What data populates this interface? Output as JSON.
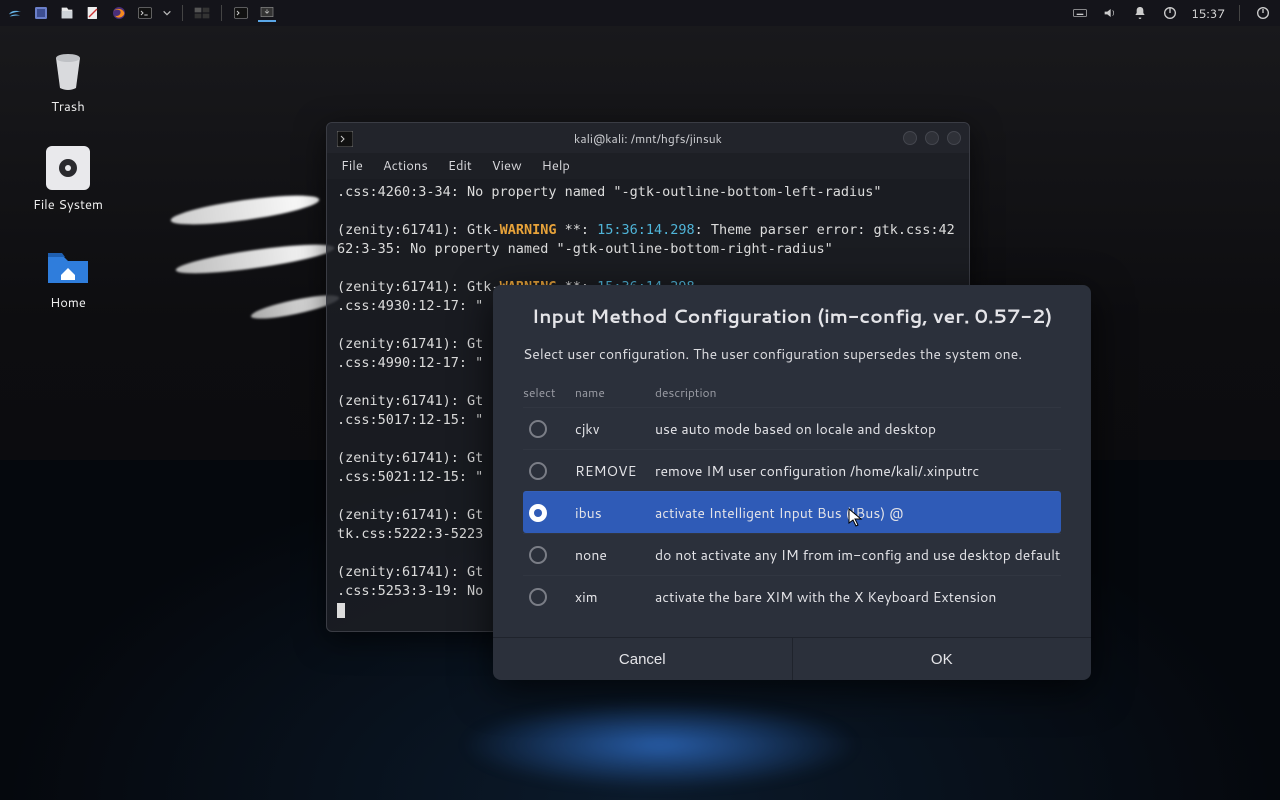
{
  "panel": {
    "clock": "15:37"
  },
  "desktop": {
    "trash": "Trash",
    "filesystem": "File System",
    "home": "Home"
  },
  "terminal": {
    "title": "kali@kali: /mnt/hgfs/jinsuk",
    "menu": {
      "file": "File",
      "actions": "Actions",
      "edit": "Edit",
      "view": "View",
      "help": "Help"
    },
    "lines": {
      "l1a": ".css:4260:3-34: No property named \"-gtk-outline-bottom-left-radius\"",
      "l2pre": "(zenity:61741): Gtk-",
      "warn": "WARNING",
      "l2mid": " **: ",
      "ts": "15:36:14.298",
      "l2post": ": Theme parser error: gtk.css:4262:3-35: No property named \"-gtk-outline-bottom-right-radius\"",
      "l3": "(zenity:61741): Gtk",
      "l3b": ".css:4930:12-17: \"",
      "l4": "(zenity:61741): Gt",
      "l4b": ".css:4990:12-17: \"",
      "l5": "(zenity:61741): Gt",
      "l5b": ".css:5017:12-15: \"",
      "l6": "(zenity:61741): Gt",
      "l6b": ".css:5021:12-15: \"",
      "l7": "(zenity:61741): Gt",
      "l7b": "tk.css:5222:3-5223",
      "l8": "(zenity:61741): Gt",
      "l8b": ".css:5253:3-19: No"
    }
  },
  "dialog": {
    "title": "Input Method Configuration (im-config, ver. 0.57-2)",
    "subtitle": "Select user configuration. The user configuration supersedes the system one.",
    "headers": {
      "select": "select",
      "name": "name",
      "description": "description"
    },
    "rows": [
      {
        "name": "cjkv",
        "desc": "use auto mode based on locale and desktop",
        "selected": false
      },
      {
        "name": "REMOVE",
        "desc": "remove IM user configuration /home/kali/.xinputrc",
        "selected": false
      },
      {
        "name": "ibus",
        "desc": "activate Intelligent Input Bus (IBus) @",
        "selected": true
      },
      {
        "name": "none",
        "desc": "do not activate any IM from im-config and use desktop default",
        "selected": false
      },
      {
        "name": "xim",
        "desc": "activate the bare XIM with the X Keyboard Extension",
        "selected": false
      }
    ],
    "cancel": "Cancel",
    "ok": "OK"
  }
}
